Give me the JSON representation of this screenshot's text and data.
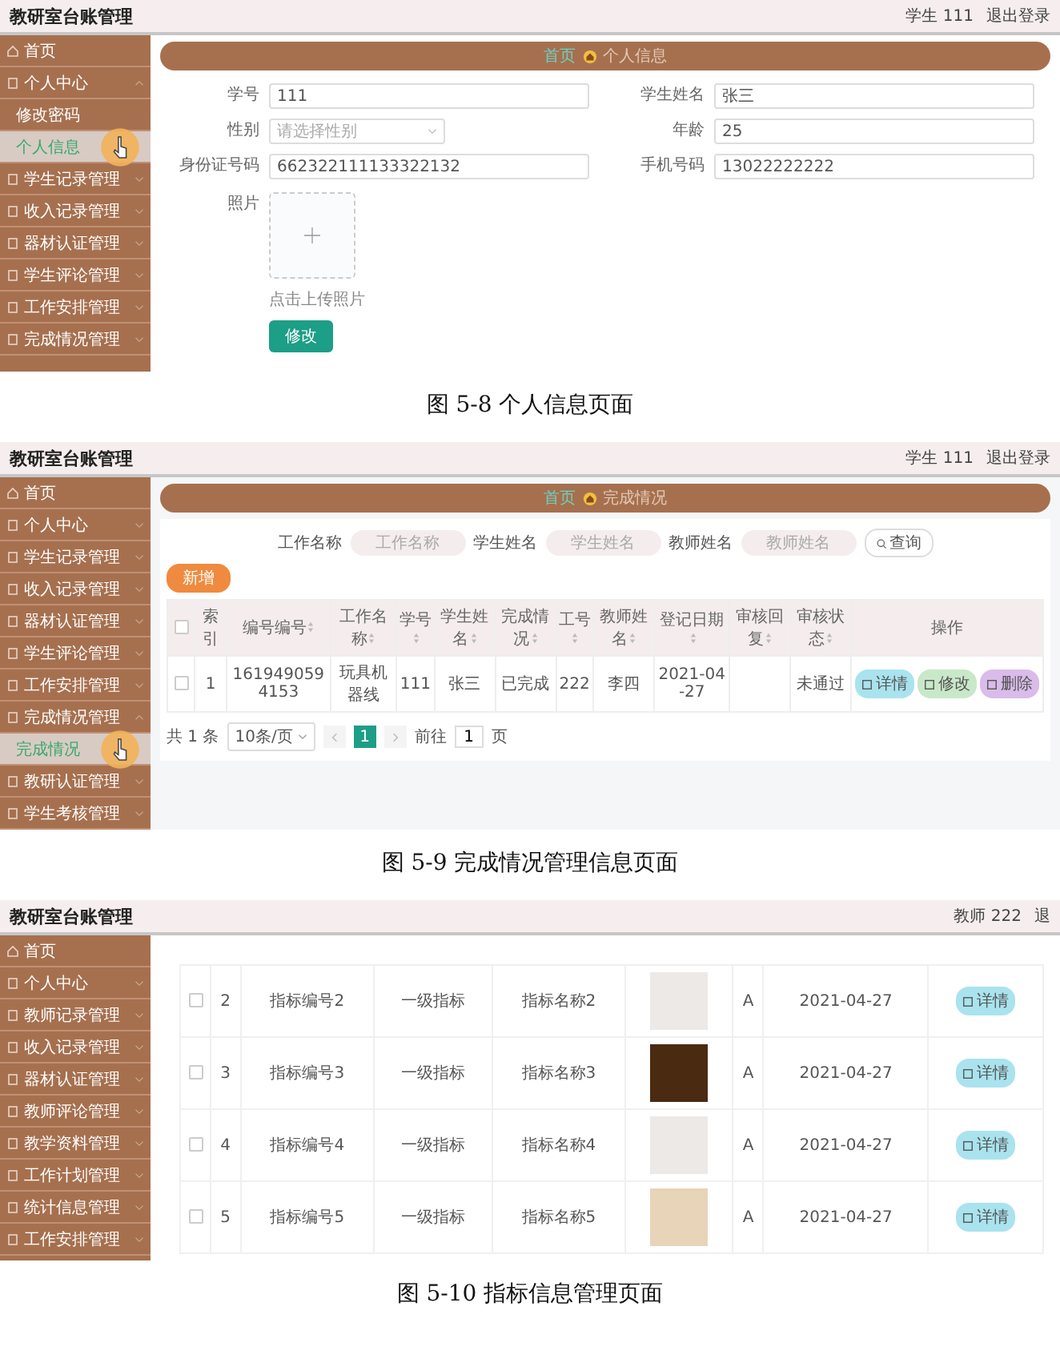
{
  "figures": [
    {
      "kind": "profile",
      "topbar": {
        "title": "教研室台账管理",
        "user": "学生 111",
        "logout": "退出登录"
      },
      "sidebar": [
        {
          "label": "首页",
          "kind": "link",
          "selected": false
        },
        {
          "label": "个人中心",
          "kind": "group",
          "expanded": true,
          "selected": false,
          "children": [
            {
              "label": "修改密码",
              "selected": false
            },
            {
              "label": "个人信息",
              "selected": true
            }
          ]
        },
        {
          "label": "学生记录管理",
          "kind": "group",
          "expanded": false,
          "selected": false
        },
        {
          "label": "收入记录管理",
          "kind": "group",
          "expanded": false,
          "selected": false
        },
        {
          "label": "器材认证管理",
          "kind": "group",
          "expanded": false,
          "selected": false
        },
        {
          "label": "学生评论管理",
          "kind": "group",
          "expanded": false,
          "selected": false
        },
        {
          "label": "工作安排管理",
          "kind": "group",
          "expanded": false,
          "selected": false
        },
        {
          "label": "完成情况管理",
          "kind": "group",
          "expanded": false,
          "selected": false
        }
      ],
      "breadcrumb": {
        "home": "首页",
        "current": "个人信息"
      },
      "form": {
        "fields": [
          {
            "label": "学号",
            "kind": "text",
            "value": "111"
          },
          {
            "label": "学生姓名",
            "kind": "text",
            "value": "张三"
          },
          {
            "label": "性别",
            "kind": "select",
            "placeholder": "请选择性别"
          },
          {
            "label": "年龄",
            "kind": "text",
            "value": "25"
          },
          {
            "label": "身份证号码",
            "kind": "text",
            "value": "662322111133322132"
          },
          {
            "label": "手机号码",
            "kind": "text",
            "value": "13022222222"
          }
        ],
        "photo": {
          "label": "照片",
          "hint": "点击上传照片"
        },
        "submit": "修改"
      },
      "caption": "图 5-8 个人信息页面"
    },
    {
      "kind": "records",
      "topbar": {
        "title": "教研室台账管理",
        "user": "学生 111",
        "logout": "退出登录"
      },
      "sidebar": [
        {
          "label": "首页",
          "kind": "link",
          "selected": false
        },
        {
          "label": "个人中心",
          "kind": "group",
          "expanded": false,
          "selected": false
        },
        {
          "label": "学生记录管理",
          "kind": "group",
          "expanded": false,
          "selected": false
        },
        {
          "label": "收入记录管理",
          "kind": "group",
          "expanded": false,
          "selected": false
        },
        {
          "label": "器材认证管理",
          "kind": "group",
          "expanded": false,
          "selected": false
        },
        {
          "label": "学生评论管理",
          "kind": "group",
          "expanded": false,
          "selected": false
        },
        {
          "label": "工作安排管理",
          "kind": "group",
          "expanded": false,
          "selected": false
        },
        {
          "label": "完成情况管理",
          "kind": "group",
          "expanded": true,
          "selected": false,
          "children": [
            {
              "label": "完成情况",
              "selected": true
            }
          ]
        },
        {
          "label": "教研认证管理",
          "kind": "group",
          "expanded": false,
          "selected": false
        },
        {
          "label": "学生考核管理",
          "kind": "group",
          "expanded": false,
          "selected": false
        }
      ],
      "breadcrumb": {
        "home": "首页",
        "current": "完成情况"
      },
      "search": {
        "fields": [
          {
            "label": "工作名称",
            "placeholder": "工作名称"
          },
          {
            "label": "学生姓名",
            "placeholder": "学生姓名"
          },
          {
            "label": "教师姓名",
            "placeholder": "教师姓名"
          }
        ],
        "button": "查询"
      },
      "add_button": "新增",
      "table": {
        "select_all": {
          "checked": false
        },
        "columns": [
          {
            "label": "索引",
            "sortable": false
          },
          {
            "label": "编号编号",
            "sortable": true
          },
          {
            "label": "工作名称",
            "sortable": true
          },
          {
            "label": "学号",
            "sortable": true
          },
          {
            "label": "学生姓名",
            "sortable": true
          },
          {
            "label": "完成情况",
            "sortable": true
          },
          {
            "label": "工号",
            "sortable": true
          },
          {
            "label": "教师姓名",
            "sortable": true
          },
          {
            "label": "登记日期",
            "sortable": true
          },
          {
            "label": "审核回复",
            "sortable": true
          },
          {
            "label": "审核状态",
            "sortable": true
          },
          {
            "label": "操作",
            "sortable": false
          }
        ],
        "rows": [
          {
            "checked": false,
            "cells": [
              "1",
              "1619490594153",
              "玩具机器线",
              "111",
              "张三",
              "已完成",
              "222",
              "李四",
              "2021-04-27",
              null,
              "未通过"
            ],
            "actions": [
              {
                "kind": "detail",
                "label": "详情"
              },
              {
                "kind": "edit",
                "label": "修改"
              },
              {
                "kind": "delete",
                "label": "删除"
              }
            ]
          }
        ]
      },
      "pagination": {
        "total": "共 1 条",
        "page_size": "10条/页",
        "pages": [
          {
            "label": "1",
            "selected": true
          }
        ],
        "goto_label": "前往",
        "goto_value": "1",
        "goto_unit": "页"
      },
      "caption": "图 5-9 完成情况管理信息页面"
    },
    {
      "kind": "indicators",
      "topbar": {
        "title": "教研室台账管理",
        "user": "教师 222",
        "logout": "退"
      },
      "sidebar": [
        {
          "label": "首页",
          "kind": "link",
          "selected": false
        },
        {
          "label": "个人中心",
          "kind": "group",
          "expanded": false,
          "selected": false
        },
        {
          "label": "教师记录管理",
          "kind": "group",
          "expanded": false,
          "selected": false
        },
        {
          "label": "收入记录管理",
          "kind": "group",
          "expanded": false,
          "selected": false
        },
        {
          "label": "器材认证管理",
          "kind": "group",
          "expanded": false,
          "selected": false
        },
        {
          "label": "教师评论管理",
          "kind": "group",
          "expanded": false,
          "selected": false
        },
        {
          "label": "教学资料管理",
          "kind": "group",
          "expanded": false,
          "selected": false
        },
        {
          "label": "工作计划管理",
          "kind": "group",
          "expanded": false,
          "selected": false
        },
        {
          "label": "统计信息管理",
          "kind": "group",
          "expanded": false,
          "selected": false
        },
        {
          "label": "工作安排管理",
          "kind": "group",
          "expanded": false,
          "selected": false
        }
      ],
      "table": {
        "rows": [
          {
            "checked": false,
            "cells": [
              "2",
              "指标编号2",
              "一级指标",
              "指标名称2",
              "A",
              "2021-04-27"
            ],
            "action": "详情"
          },
          {
            "checked": false,
            "cells": [
              "3",
              "指标编号3",
              "一级指标",
              "指标名称3",
              "A",
              "2021-04-27"
            ],
            "action": "详情"
          },
          {
            "checked": false,
            "cells": [
              "4",
              "指标编号4",
              "一级指标",
              "指标名称4",
              "A",
              "2021-04-27"
            ],
            "action": "详情"
          },
          {
            "checked": false,
            "cells": [
              "5",
              "指标编号5",
              "一级指标",
              "指标名称5",
              "A",
              "2021-04-27"
            ],
            "action": "详情"
          }
        ]
      },
      "caption": "图 5-10 指标信息管理页面"
    }
  ]
}
